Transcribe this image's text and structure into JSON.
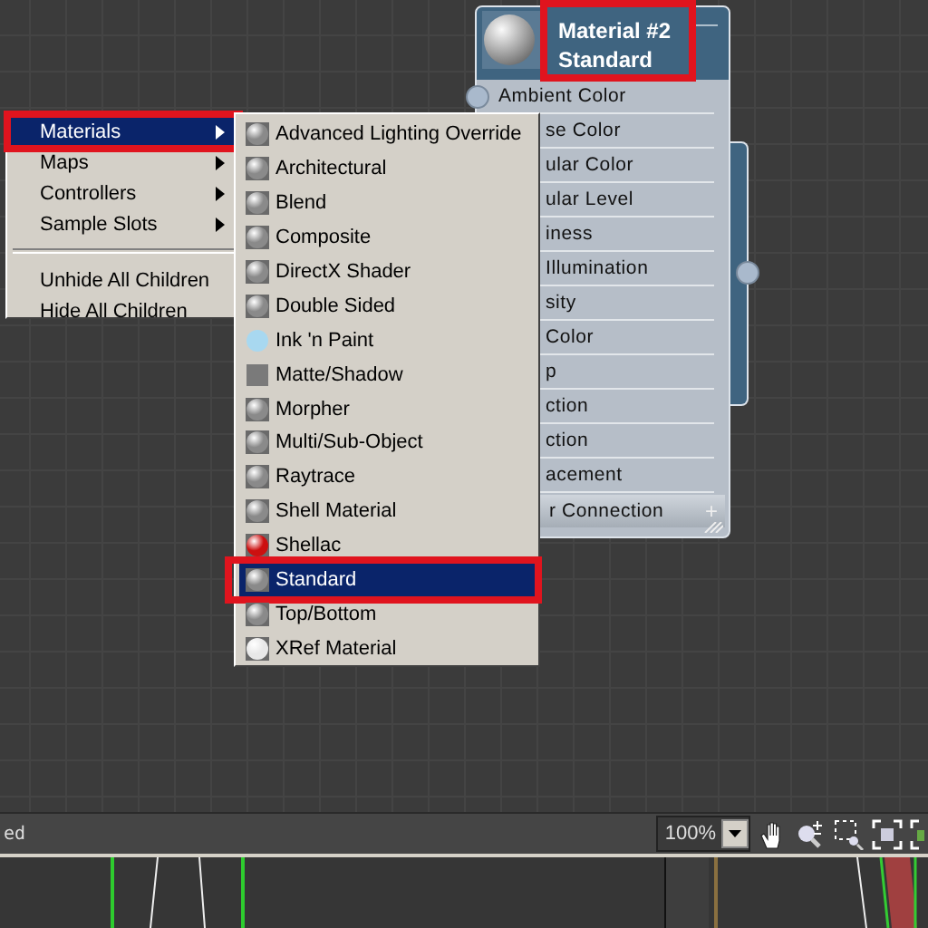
{
  "node": {
    "title": "Material #2",
    "subtitle": "Standard",
    "collapse": "—",
    "slots": [
      {
        "label": "Ambient Color",
        "kind": "full"
      },
      {
        "label": "se Color",
        "kind": "partial"
      },
      {
        "label": "ular Color",
        "kind": "partial"
      },
      {
        "label": "ular Level",
        "kind": "partial"
      },
      {
        "label": "iness",
        "kind": "partial"
      },
      {
        "label": "Illumination",
        "kind": "partial"
      },
      {
        "label": "sity",
        "kind": "partial"
      },
      {
        "label": "Color",
        "kind": "partial"
      },
      {
        "label": "p",
        "kind": "partial"
      },
      {
        "label": "ction",
        "kind": "partial"
      },
      {
        "label": "ction",
        "kind": "partial"
      },
      {
        "label": "acement",
        "kind": "partial"
      },
      {
        "label": "r Connection",
        "kind": "extra",
        "action": "+"
      }
    ]
  },
  "context_menu": {
    "groups": [
      {
        "items": [
          {
            "label": "Materials",
            "submenu": true,
            "selected": true,
            "highlighted": true
          },
          {
            "label": "Maps",
            "submenu": true,
            "selected": false,
            "highlighted": false
          },
          {
            "label": "Controllers",
            "submenu": true,
            "selected": false,
            "highlighted": false
          },
          {
            "label": "Sample Slots",
            "submenu": true,
            "selected": false,
            "highlighted": false
          }
        ]
      },
      {
        "items": [
          {
            "label": "Unhide All Children",
            "submenu": false,
            "selected": false,
            "highlighted": false
          },
          {
            "label": "Hide All Children",
            "submenu": false,
            "selected": false,
            "highlighted": false
          }
        ]
      }
    ]
  },
  "submenu": {
    "items": [
      {
        "label": "Advanced Lighting Override",
        "kind": "sphere",
        "color": "#8a8a8a",
        "selected": false,
        "highlighted": false
      },
      {
        "label": "Architectural",
        "kind": "sphere",
        "color": "#8a8a8a",
        "selected": false,
        "highlighted": false
      },
      {
        "label": "Blend",
        "kind": "sphere",
        "color": "#8a8a8a",
        "selected": false,
        "highlighted": false
      },
      {
        "label": "Composite",
        "kind": "sphere",
        "color": "#8a8a8a",
        "selected": false,
        "highlighted": false
      },
      {
        "label": "DirectX Shader",
        "kind": "sphere",
        "color": "#8a8a8a",
        "selected": false,
        "highlighted": false
      },
      {
        "label": "Double Sided",
        "kind": "sphere",
        "color": "#8a8a8a",
        "selected": false,
        "highlighted": false
      },
      {
        "label": "Ink 'n Paint",
        "kind": "flat-sphere",
        "color": "#a8d8f0",
        "selected": false,
        "highlighted": false
      },
      {
        "label": "Matte/Shadow",
        "kind": "square",
        "color": "#7a7a7a",
        "selected": false,
        "highlighted": false
      },
      {
        "label": "Morpher",
        "kind": "sphere",
        "color": "#8a8a8a",
        "selected": false,
        "highlighted": false
      },
      {
        "label": "Multi/Sub-Object",
        "kind": "sphere",
        "color": "#8a8a8a",
        "selected": false,
        "highlighted": false
      },
      {
        "label": "Raytrace",
        "kind": "sphere",
        "color": "#8a8a8a",
        "selected": false,
        "highlighted": false
      },
      {
        "label": "Shell Material",
        "kind": "sphere",
        "color": "#8a8a8a",
        "selected": false,
        "highlighted": false
      },
      {
        "label": "Shellac",
        "kind": "sphere",
        "color": "#cc1010",
        "selected": false,
        "highlighted": false
      },
      {
        "label": "Standard",
        "kind": "sphere",
        "color": "#8a8a8a",
        "selected": true,
        "highlighted": true
      },
      {
        "label": "Top/Bottom",
        "kind": "sphere",
        "color": "#8a8a8a",
        "selected": false,
        "highlighted": false
      },
      {
        "label": "XRef Material",
        "kind": "sphere",
        "color": "#e8e8e8",
        "selected": false,
        "highlighted": false
      }
    ]
  },
  "title_highlighted": true,
  "status_bar": {
    "text": "ed",
    "zoom": "100%"
  }
}
